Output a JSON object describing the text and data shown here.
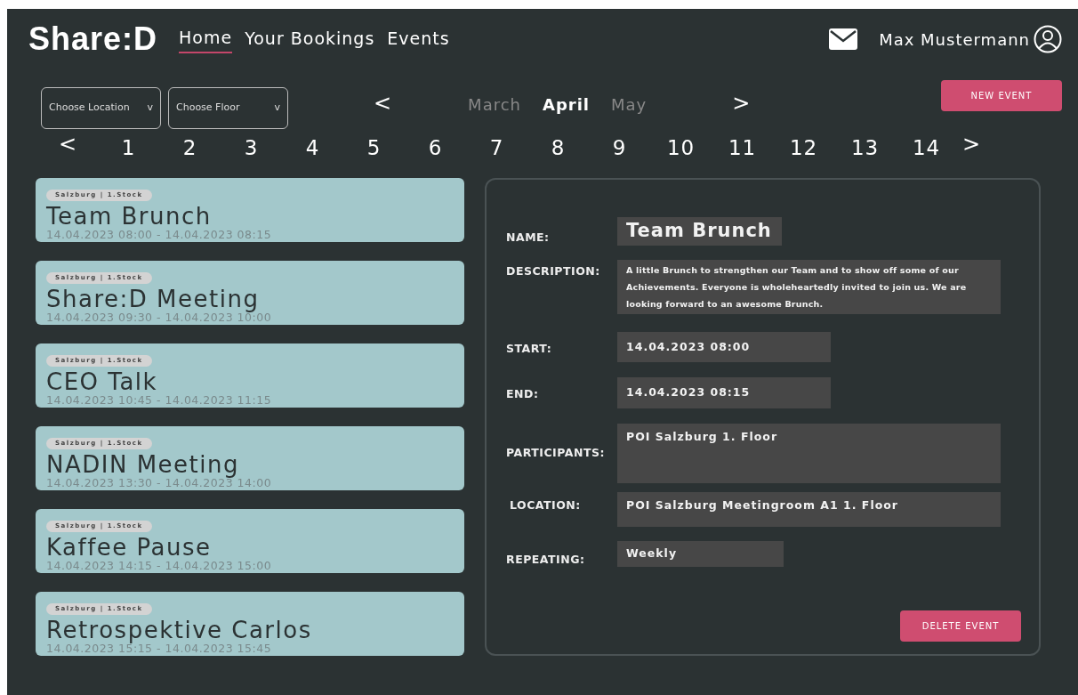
{
  "header": {
    "brand": "Share:D",
    "nav": [
      {
        "label": "Home",
        "selected": true
      },
      {
        "label": "Your Bookings",
        "selected": false
      },
      {
        "label": "Events",
        "selected": false
      }
    ],
    "user_name": "Max Mustermann"
  },
  "filters": [
    {
      "placeholder": "Choose Location",
      "caret": "v"
    },
    {
      "placeholder": "Choose Floor",
      "caret": "v"
    }
  ],
  "month_nav": {
    "prev": "<",
    "next": ">",
    "months": [
      {
        "label": "March",
        "selected": false
      },
      {
        "label": "April",
        "selected": true
      },
      {
        "label": "May",
        "selected": false
      }
    ]
  },
  "new_event_button": "NEW EVENT",
  "day_nav": {
    "prev": "<",
    "next": ">",
    "days": [
      "1",
      "2",
      "3",
      "4",
      "5",
      "6",
      "7",
      "8",
      "9",
      "10",
      "11",
      "12",
      "13",
      "14"
    ]
  },
  "events": [
    {
      "tag": "Salzburg | 1.Stock",
      "title": "Team Brunch",
      "time": "14.04.2023 08:00 - 14.04.2023 08:15"
    },
    {
      "tag": "Salzburg | 1.Stock",
      "title": "Share:D Meeting",
      "time": "14.04.2023 09:30 - 14.04.2023 10:00"
    },
    {
      "tag": "Salzburg | 1.Stock",
      "title": "CEO Talk",
      "time": "14.04.2023 10:45 - 14.04.2023 11:15"
    },
    {
      "tag": "Salzburg | 1.Stock",
      "title": "NADIN Meeting",
      "time": "14.04.2023 13:30 - 14.04.2023 14:00"
    },
    {
      "tag": "Salzburg | 1.Stock",
      "title": "Kaffee Pause",
      "time": "14.04.2023 14:15 - 14.04.2023 15:00"
    },
    {
      "tag": "Salzburg | 1.Stock",
      "title": "Retrospektive Carlos",
      "time": "14.04.2023 15:15 - 14.04.2023 15:45"
    }
  ],
  "details": {
    "fields": [
      {
        "kind": "title",
        "label": "NAME:",
        "value": "Team Brunch"
      },
      {
        "kind": "paragraph",
        "label": "DESCRIPTION:",
        "value": "A little Brunch to strengthen our Team and to show off some of our Achievements. Everyone is wholeheartedly invited to join us. We are looking forward to an awesome Brunch."
      },
      {
        "kind": "date",
        "label": "START:",
        "value": "14.04.2023 08:00"
      },
      {
        "kind": "date",
        "label": "END:",
        "value": "14.04.2023 08:15"
      },
      {
        "kind": "tall",
        "label": "PARTICIPANTS:",
        "value": "POI Salzburg 1. Floor"
      },
      {
        "kind": "line",
        "label": "LOCATION:",
        "value": "POI Salzburg Meetingroom A1 1. Floor"
      },
      {
        "kind": "short",
        "label": "REPEATING:",
        "value": "Weekly"
      }
    ],
    "delete_button": "DELETE EVENT"
  }
}
